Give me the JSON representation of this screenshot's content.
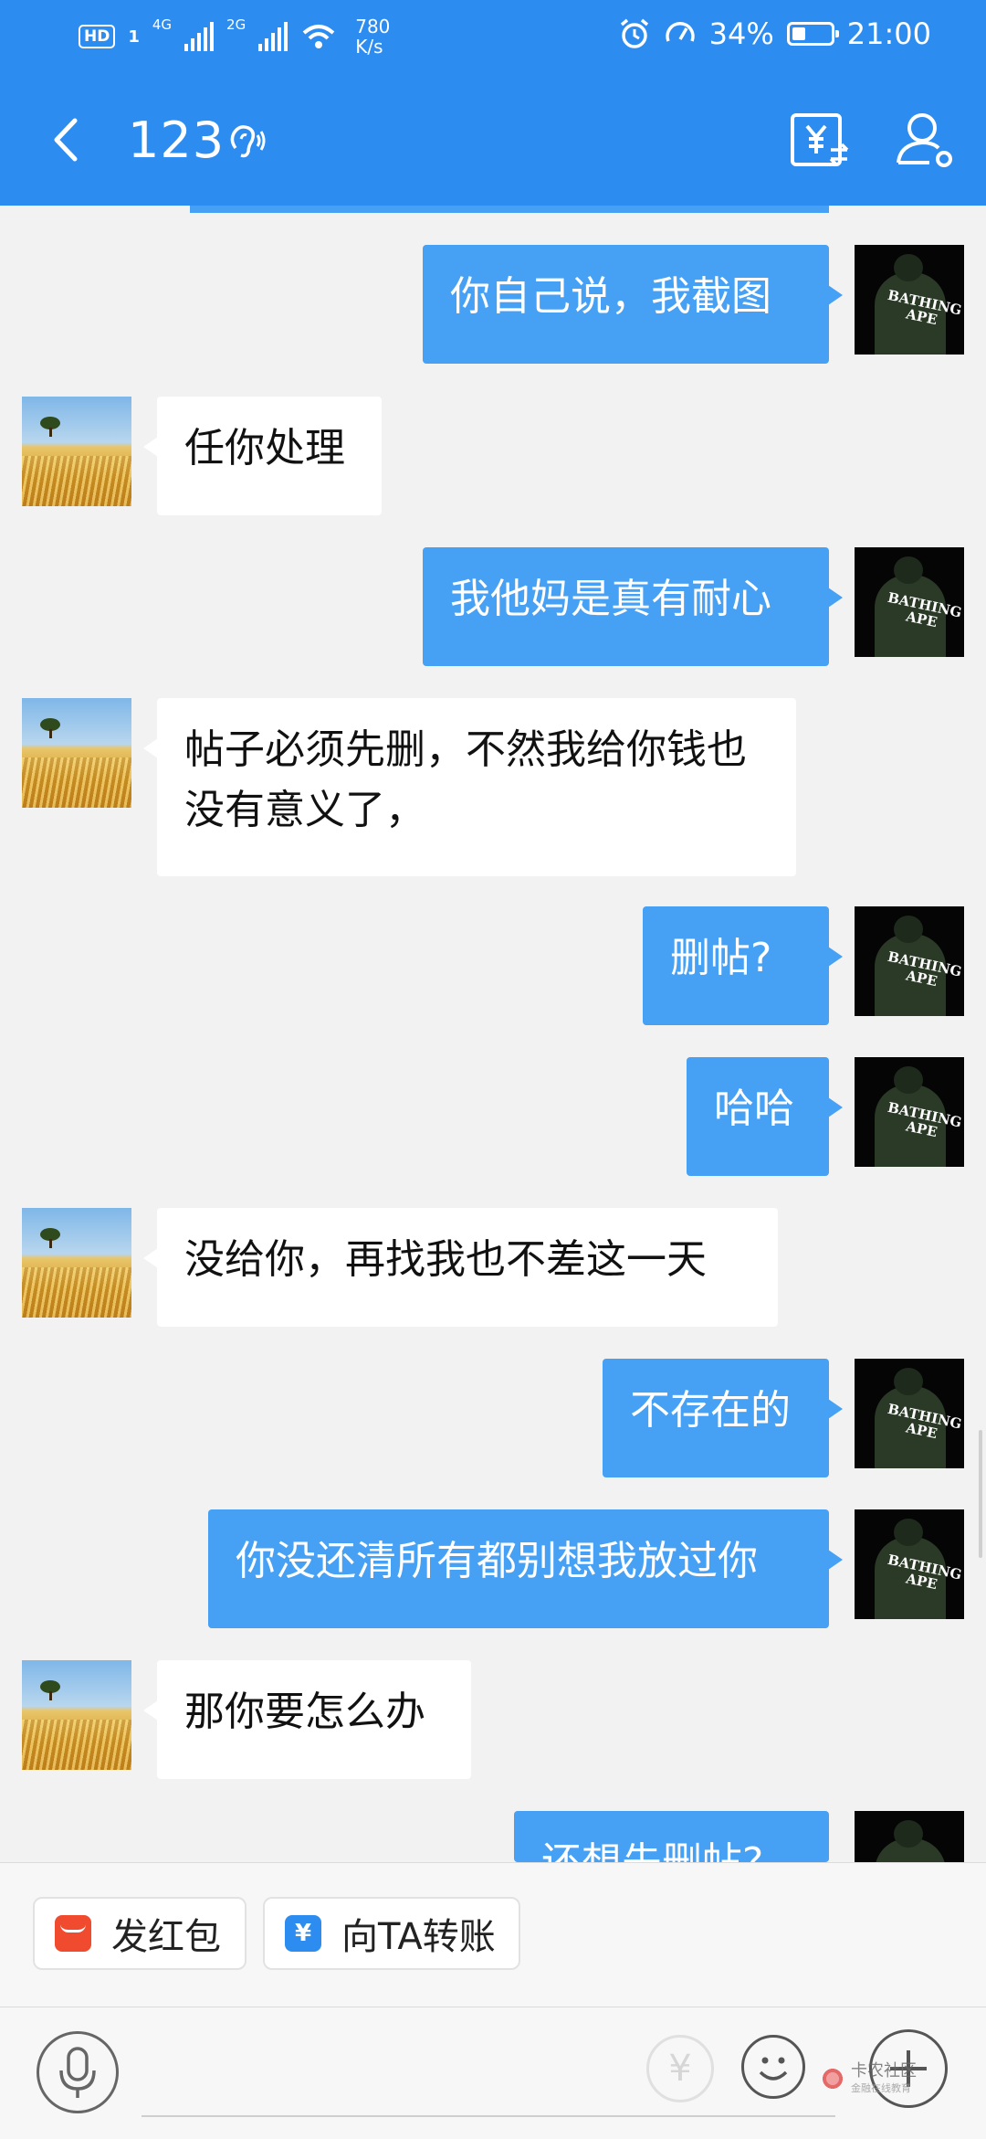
{
  "status_bar": {
    "hd_label": "HD",
    "sim_label": "1",
    "network_1": "4G",
    "network_2": "2G",
    "speed_value": "780",
    "speed_unit": "K/s",
    "battery_percent": "34%",
    "battery_level": 0.34,
    "time": "21:00"
  },
  "header": {
    "title": "123",
    "icons": [
      "back-arrow-icon",
      "hearing-icon",
      "transfer-yen-icon",
      "profile-settings-icon"
    ]
  },
  "messages": [
    {
      "side": "right",
      "text": "你自己说，我截图"
    },
    {
      "side": "left",
      "text": "任你处理"
    },
    {
      "side": "right",
      "text": "我他妈是真有耐心"
    },
    {
      "side": "left",
      "text": "帖子必须先删，不然我给你钱也没有意义了，"
    },
    {
      "side": "right",
      "text": "删帖?"
    },
    {
      "side": "right",
      "text": "哈哈"
    },
    {
      "side": "left",
      "text": "没给你，再找我也不差这一天"
    },
    {
      "side": "right",
      "text": "不存在的"
    },
    {
      "side": "right",
      "text": "你没还清所有都别想我放过你"
    },
    {
      "side": "left",
      "text": "那你要怎么办"
    },
    {
      "side": "right",
      "text": "还想先删帖?"
    }
  ],
  "actions": {
    "red_packet": "发红包",
    "transfer": "向TA转账"
  },
  "input_bar": {
    "yen_symbol": "¥",
    "watermark_name": "卡农社区",
    "watermark_sub": "金融在线教育"
  },
  "colors": {
    "header": "#2d8cf0",
    "own_bubble": "#46a0f4",
    "other_bubble": "#ffffff",
    "chat_bg": "#f2f2f2",
    "red_packet": "#f04b2e"
  }
}
